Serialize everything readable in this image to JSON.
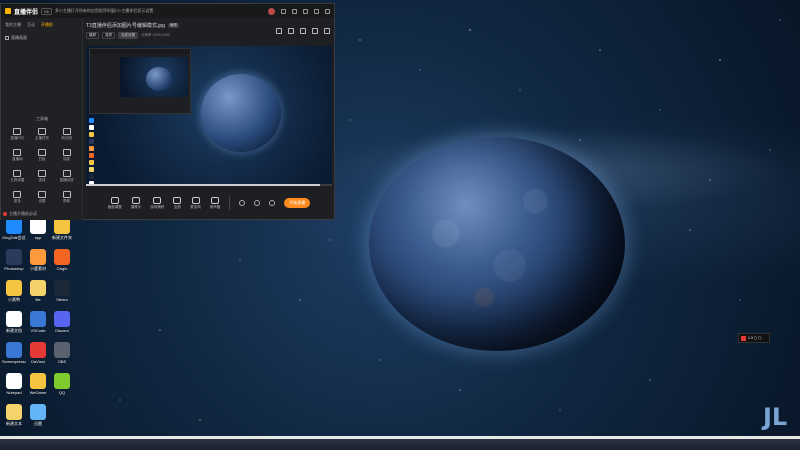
{
  "app": {
    "name": "直播伴侣",
    "version": "V6",
    "tabs": [
      {
        "label": "我的主播",
        "active": false
      },
      {
        "label": "互动",
        "active": false
      },
      {
        "label": "开播前",
        "active": true
      }
    ],
    "title_text": "多小主播打开所有的应用程序的窗口+主播伴侣显示设置",
    "accent_color": "#ff8a1d",
    "brand_color": "#ffb300"
  },
  "sidebar": {
    "scene_label": "直播画面",
    "section_title": "工具箱",
    "tools": [
      {
        "label": "直播时长",
        "icon": "clock-icon"
      },
      {
        "label": "主播任务",
        "icon": "bell-icon"
      },
      {
        "label": "粉丝团",
        "icon": "fans-icon"
      },
      {
        "label": "直播间",
        "icon": "room-icon"
      },
      {
        "label": "白板",
        "icon": "board-icon"
      },
      {
        "label": "抽奖",
        "icon": "gift-icon"
      },
      {
        "label": "礼物设置",
        "icon": "gift-settings-icon"
      },
      {
        "label": "连线",
        "icon": "link-icon"
      },
      {
        "label": "直播回放",
        "icon": "replay-icon"
      },
      {
        "label": "更多",
        "icon": "more-icon"
      },
      {
        "label": "设置",
        "icon": "gear-icon"
      },
      {
        "label": "帮助",
        "icon": "help-icon"
      }
    ],
    "footer_text": "主播开播前必读"
  },
  "main": {
    "file_title": "T3直播伴侣添加图片号编辑模式.jpg",
    "file_badge": "编辑",
    "chips": [
      "横屏",
      "竖屏",
      "连麦设置"
    ],
    "meta_text": "分辨率 1920x1080"
  },
  "toolbar": {
    "items": [
      {
        "label": "画面调整",
        "icon": "crop-icon"
      },
      {
        "label": "摄像头",
        "icon": "camera-icon"
      },
      {
        "label": "游戏捕获",
        "icon": "gamepad-icon"
      },
      {
        "label": "全部",
        "icon": "window-icon"
      },
      {
        "label": "麦克风",
        "icon": "mic-icon"
      },
      {
        "label": "扬声器",
        "icon": "speaker-icon"
      }
    ],
    "start_label": "开始直播"
  },
  "progress": 0.95,
  "desktop_icons": [
    {
      "label": "DingTalk会议",
      "color": "#1f8bff"
    },
    {
      "label": "app",
      "color": "#ffffff"
    },
    {
      "label": "新建文件夹",
      "color": "#f5c542"
    },
    {
      "label": "Photoshop",
      "color": "#2a3a5a"
    },
    {
      "label": "小鹿素材",
      "color": "#ff9a3c"
    },
    {
      "label": "Origin",
      "color": "#f26522"
    },
    {
      "label": "小黄鸭",
      "color": "#f5c542"
    },
    {
      "label": "file",
      "color": "#f5d36b"
    },
    {
      "label": "Steam",
      "color": "#1b2838"
    },
    {
      "label": "新建文档",
      "color": "#ffffff"
    },
    {
      "label": "VSCode",
      "color": "#3a78d6"
    },
    {
      "label": "Discord",
      "color": "#5865f2"
    },
    {
      "label": "Screenpresso",
      "color": "#3a78d6"
    },
    {
      "label": "DaVinci",
      "color": "#e53935"
    },
    {
      "label": "OBS",
      "color": "#5a6270"
    },
    {
      "label": "Notepad",
      "color": "#ffffff"
    },
    {
      "label": "WeGame",
      "color": "#f5c542"
    },
    {
      "label": "QQ",
      "color": "#7ecb2f"
    },
    {
      "label": "新建文本",
      "color": "#f5d36b"
    },
    {
      "label": "迅雷",
      "color": "#64b5f6"
    }
  ],
  "tray_widget_text": "1.3 ▢ ▢"
}
